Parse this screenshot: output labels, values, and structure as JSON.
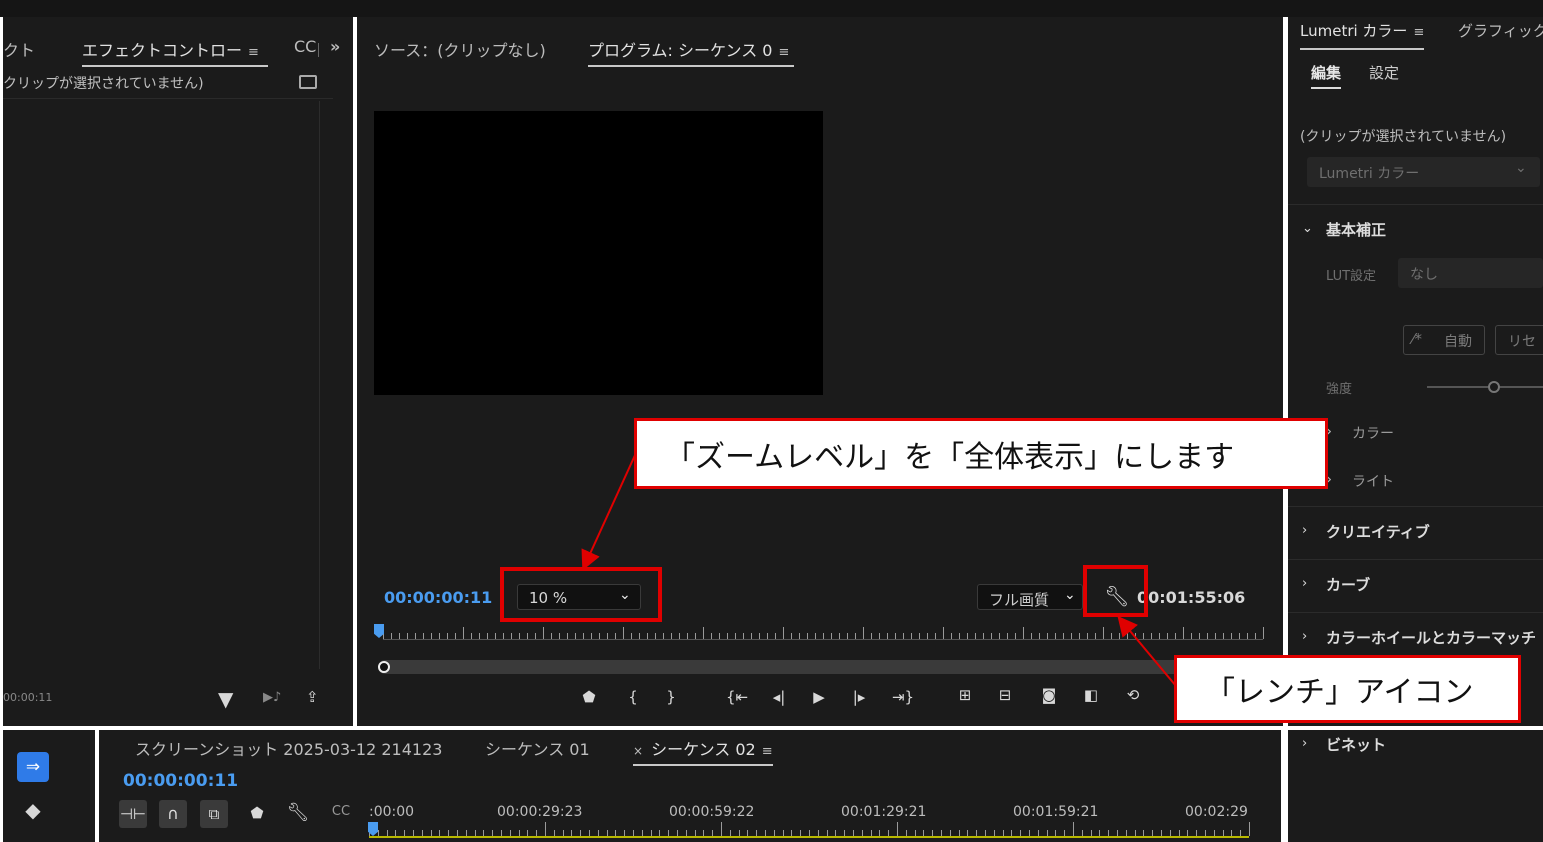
{
  "left_panel": {
    "tab_partial": "クト",
    "tab_effect_controls": "エフェクトコントロー",
    "tab_menu": "≡",
    "tab_cc": "CC",
    "tab_more": "»",
    "no_clip": "クリップが選択されていません)",
    "timecode": "00:00:11"
  },
  "program_monitor": {
    "tab_source": "ソース：(クリップなし)",
    "tab_program": "プログラム: シーケンス 0",
    "tab_menu": "≡",
    "timecode_current": "00:00:00:11",
    "zoom_value": "10 %",
    "quality_value": "フル画質",
    "timecode_duration": "00:01:55:06",
    "playhead_fraction": 0.0
  },
  "lumetri": {
    "tab_lumetri": "Lumetri カラー",
    "tab_menu": "≡",
    "tab_graphics": "グラフィック",
    "subtab_edit": "編集",
    "subtab_settings": "設定",
    "no_clip": "(クリップが選択されていません)",
    "select_value": "Lumetri カラー",
    "sec_basic": "基本補正",
    "lut_label": "LUT設定",
    "lut_value": "なし",
    "auto_button": "自動",
    "reset_button": "リセ",
    "intensity_label": "強度",
    "sub_color": "カラー",
    "sub_light": "ライト",
    "sec_creative": "クリエイティブ",
    "sec_curves": "カーブ",
    "sec_wheels": "カラーホイールとカラーマッチ",
    "sec_vignette": "ビネット"
  },
  "timeline": {
    "tab_screenshot": "スクリーンショット 2025-03-12 214123",
    "tab_seq01": "シーケンス 01",
    "tab_close": "×",
    "tab_seq02": "シーケンス 02",
    "tab_menu": "≡",
    "timecode": "00:00:00:11",
    "ruler_labels": [
      ":00:00",
      "00:00:29:23",
      "00:00:59:22",
      "00:01:29:21",
      "00:01:59:21",
      "00:02:29"
    ]
  },
  "annotations": {
    "zoom_callout": "「ズームレベル」を「全体表示」にします",
    "wrench_callout": "「レンチ」アイコン"
  },
  "colors": {
    "accent_blue": "#4a9cf0",
    "highlight_red": "#e00000",
    "panel_bg": "#1b1b1b"
  }
}
